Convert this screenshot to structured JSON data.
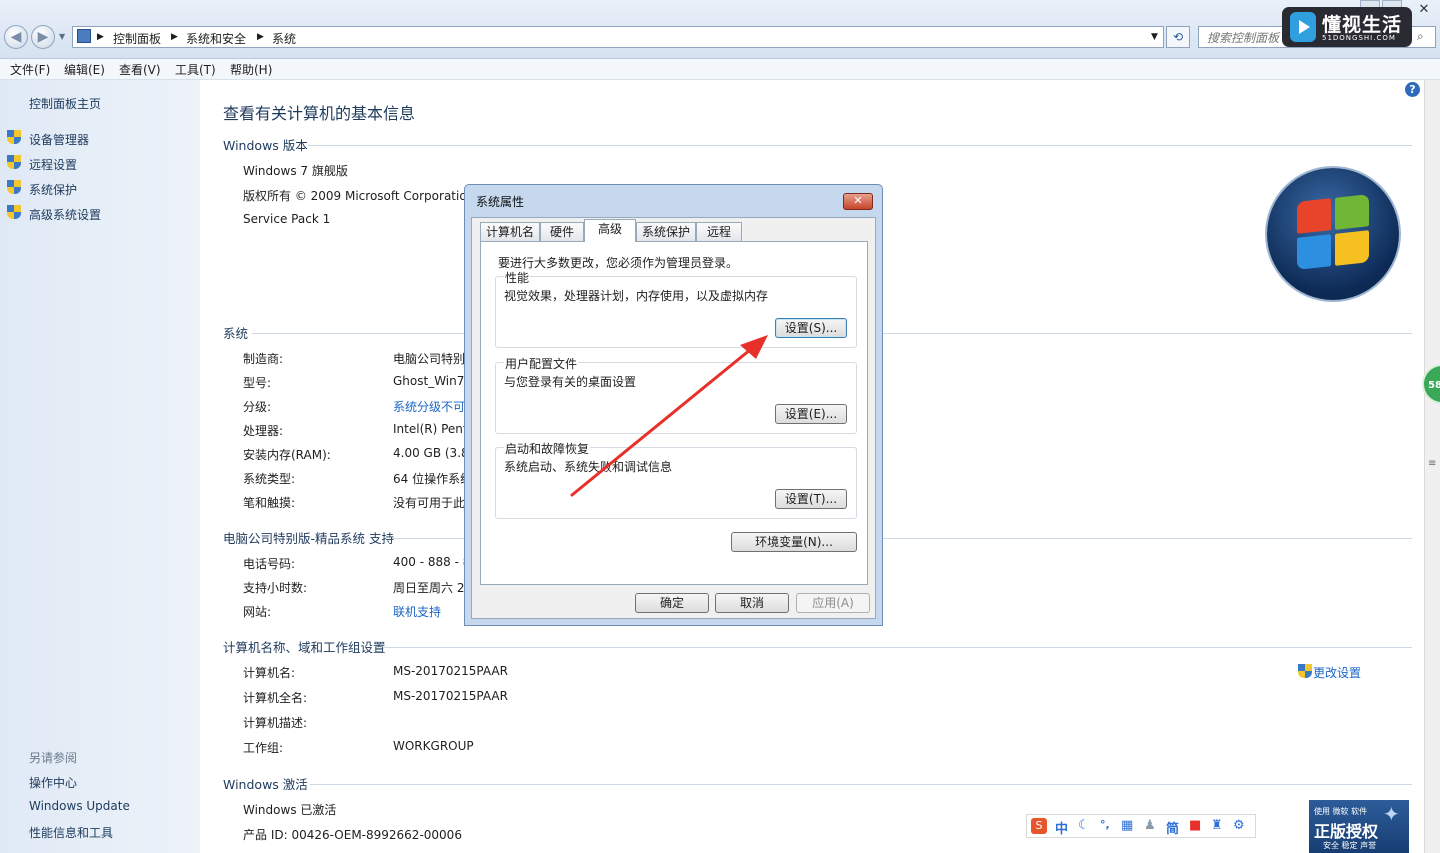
{
  "address_bar": {
    "breadcrumb": [
      "控制面板",
      "系统和安全",
      "系统"
    ],
    "search_placeholder": "搜索控制面板"
  },
  "watermark": {
    "title": "懂视生活",
    "subtitle": "51DONGSHI.COM"
  },
  "menu": [
    "文件(F)",
    "编辑(E)",
    "查看(V)",
    "工具(T)",
    "帮助(H)"
  ],
  "left_pane": {
    "home": "控制面板主页",
    "links": [
      "设备管理器",
      "远程设置",
      "系统保护",
      "高级系统设置"
    ],
    "see_also_title": "另请参阅",
    "see_also": [
      "操作中心",
      "Windows Update",
      "性能信息和工具"
    ]
  },
  "main": {
    "title": "查看有关计算机的基本信息",
    "edition": {
      "heading": "Windows 版本",
      "lines": [
        "Windows 7 旗舰版",
        "版权所有 © 2009 Microsoft Corporatio",
        "Service Pack 1"
      ]
    },
    "system": {
      "heading": "系统",
      "rows": [
        {
          "label": "制造商:",
          "value": "电脑公司特别"
        },
        {
          "label": "型号:",
          "value": "Ghost_Win7"
        },
        {
          "label": "分级:",
          "value": "系统分级不可"
        },
        {
          "label": "处理器:",
          "value": "Intel(R) Pent"
        },
        {
          "label": "安装内存(RAM):",
          "value": "4.00 GB (3.8"
        },
        {
          "label": "系统类型:",
          "value": "64 位操作系统"
        },
        {
          "label": "笔和触摸:",
          "value": "没有可用于此"
        }
      ]
    },
    "support": {
      "heading": "电脑公司特别版-精品系统 支持",
      "rows": [
        {
          "label": "电话号码:",
          "value": "400 - 888 - 8"
        },
        {
          "label": "支持小时数:",
          "value": "周日至周六  2"
        },
        {
          "label": "网站:",
          "value": "联机支持"
        }
      ]
    },
    "computer": {
      "heading": "计算机名称、域和工作组设置",
      "change_link": "更改设置",
      "rows": [
        {
          "label": "计算机名:",
          "value": "MS-20170215PAAR"
        },
        {
          "label": "计算机全名:",
          "value": "MS-20170215PAAR"
        },
        {
          "label": "计算机描述:",
          "value": ""
        },
        {
          "label": "工作组:",
          "value": "WORKGROUP"
        }
      ]
    },
    "activation": {
      "heading": "Windows 激活",
      "status": "Windows 已激活",
      "product_id": "产品 ID: 00426-OEM-8992662-00006"
    }
  },
  "dialog": {
    "title": "系统属性",
    "tabs": [
      "计算机名",
      "硬件",
      "高级",
      "系统保护",
      "远程"
    ],
    "active_tab": "高级",
    "admin_note": "要进行大多数更改，您必须作为管理员登录。",
    "groups": [
      {
        "title": "性能",
        "desc": "视觉效果，处理器计划，内存使用，以及虚拟内存",
        "button": "设置(S)..."
      },
      {
        "title": "用户配置文件",
        "desc": "与您登录有关的桌面设置",
        "button": "设置(E)..."
      },
      {
        "title": "启动和故障恢复",
        "desc": "系统启动、系统失败和调试信息",
        "button": "设置(T)..."
      }
    ],
    "env_button": "环境变量(N)...",
    "ok": "确定",
    "cancel": "取消",
    "apply": "应用(A)"
  },
  "ime_toolbar": {
    "items": [
      "中",
      "简"
    ]
  },
  "genuine_badge": {
    "top": "使用 微软 软件",
    "main": "正版授权",
    "sub": "安全 稳定 声誉"
  },
  "side_badge": "58",
  "colors": {
    "link": "#1a66c7",
    "annotation_arrow": "#e8302a"
  }
}
